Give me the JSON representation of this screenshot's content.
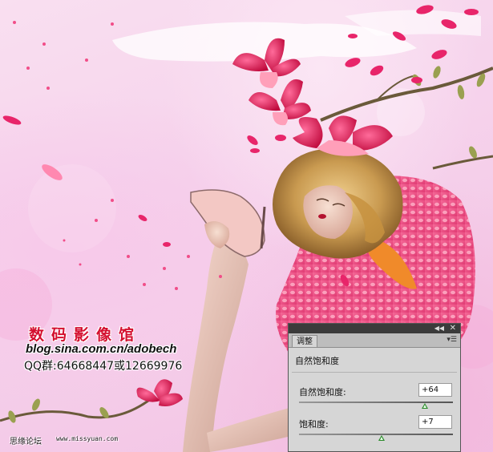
{
  "watermark": {
    "studio_name": "数码影像馆",
    "blog": "blog.sina.com.cn/adobech",
    "qq": "QQ群:64668447或12669976",
    "forum": "思缘论坛",
    "url": "www.missyuan.com"
  },
  "panel": {
    "tab_label": "调整",
    "collapse_icon": "double-chevron-right",
    "close_icon": "close",
    "menu_icon": "panel-menu",
    "adjustment_title": "自然饱和度",
    "sliders": [
      {
        "label": "自然饱和度:",
        "value": "+64",
        "numeric": 64,
        "min": -100,
        "max": 100
      },
      {
        "label": "饱和度:",
        "value": "+7",
        "numeric": 7,
        "min": -100,
        "max": 100
      }
    ]
  },
  "colors": {
    "accent_red": "#d40f2f",
    "slider_thumb": "#2a8a2a"
  }
}
